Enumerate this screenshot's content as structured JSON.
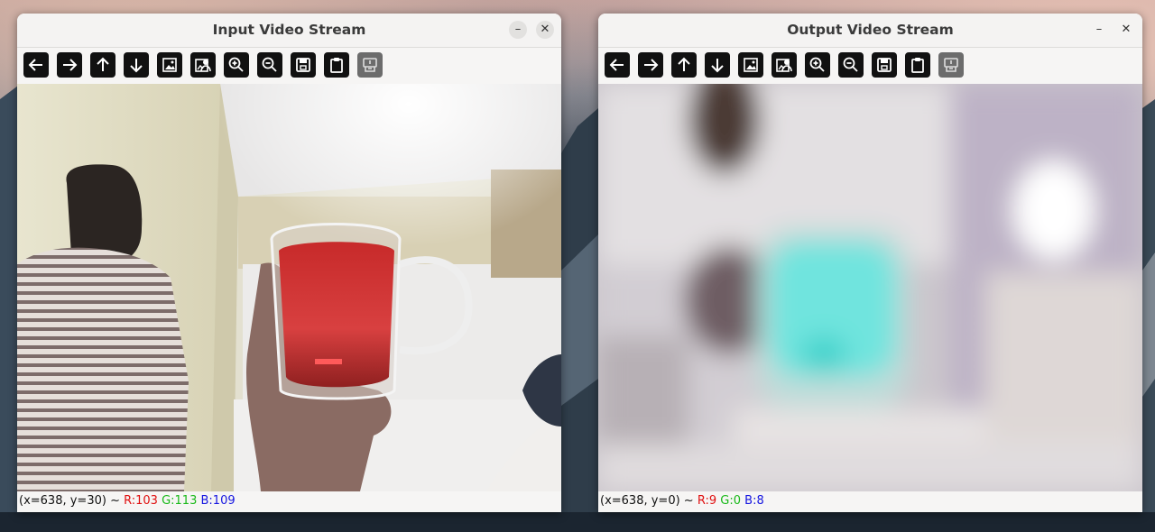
{
  "windows": [
    {
      "title": "Input Video Stream",
      "status": {
        "coords": "(x=638, y=30) ~",
        "r": "R:103",
        "g": "G:113",
        "b": "B:109"
      }
    },
    {
      "title": "Output Video Stream",
      "status": {
        "coords": "(x=638, y=0) ~",
        "r": "R:9",
        "g": "G:0",
        "b": "B:8"
      }
    }
  ],
  "window_controls": {
    "minimize": "–",
    "close": "✕"
  },
  "toolbar_icons": [
    "arrow-left-icon",
    "arrow-right-icon",
    "arrow-up-icon",
    "arrow-down-icon",
    "image-icon",
    "image-person-icon",
    "zoom-in-icon",
    "zoom-out-icon",
    "save-icon",
    "clipboard-icon",
    "properties-icon"
  ]
}
